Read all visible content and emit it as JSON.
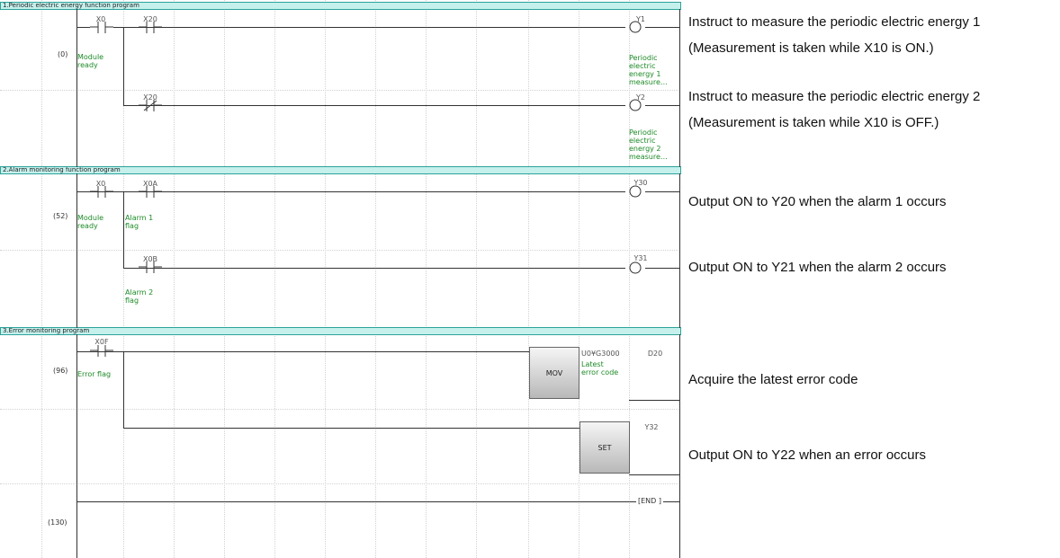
{
  "sections": [
    {
      "title": "1.Periodic electric energy function program"
    },
    {
      "title": "2.Alarm monitoring function program"
    },
    {
      "title": "3.Error monitoring program"
    }
  ],
  "steps": [
    "(0)",
    "(52)",
    "(96)",
    "(130)"
  ],
  "devices": {
    "x0_a": "X0",
    "x20_a": "X20",
    "y1": "Y1",
    "x20_b": "X20",
    "y2": "Y2",
    "x0_b": "X0",
    "x0a": "X0A",
    "y30": "Y30",
    "x0b": "X0B",
    "y31": "Y31",
    "x0f": "X0F",
    "u0g3000": "U0¥G3000",
    "d20": "D20",
    "y32": "Y32"
  },
  "comments": {
    "module_ready_1": "Module\nready",
    "pe1": "Periodic\nelectric\nenergy 1\nmeasure…",
    "pe2": "Periodic\nelectric\nenergy 2\nmeasure…",
    "module_ready_2": "Module\nready",
    "alarm1": "Alarm 1\nflag",
    "alarm2": "Alarm 2\nflag",
    "error_flag": "Error flag",
    "latest_error": "Latest\nerror code"
  },
  "instructions": {
    "mov": "MOV",
    "set": "SET",
    "end": "[END ]"
  },
  "notes": [
    "Instruct to measure the periodic electric energy 1",
    "(Measurement is taken while X10 is ON.)",
    "Instruct to measure the periodic electric energy 2",
    "(Measurement is taken while X10 is OFF.)",
    "Output ON to Y20 when the alarm 1 occurs",
    "Output ON to Y21 when the alarm 2 occurs",
    "Acquire the latest error code",
    "Output ON to Y22 when an error occurs"
  ]
}
